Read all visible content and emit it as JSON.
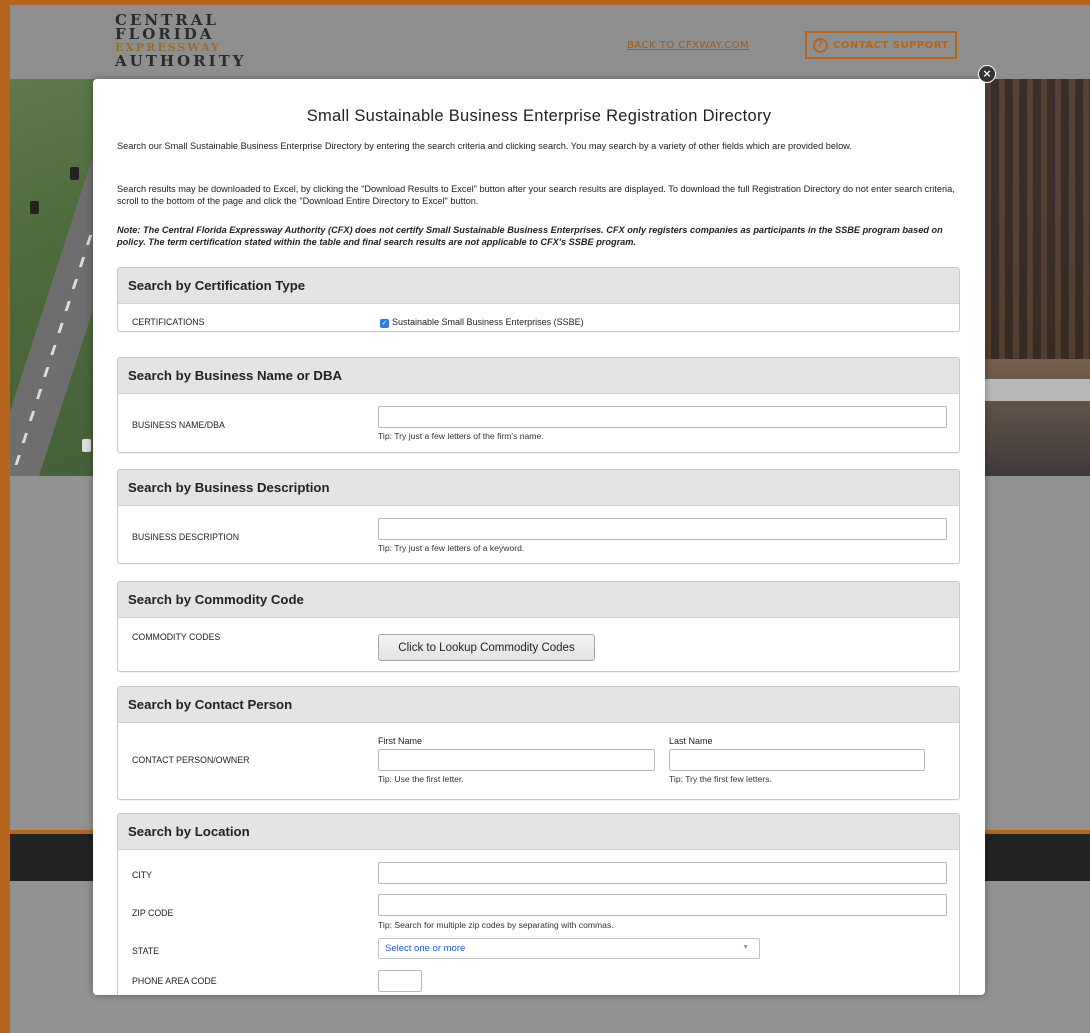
{
  "site": {
    "logo_lines": [
      "CENTRAL",
      "FLORIDA",
      "EXPRESSWAY",
      "AUTHORITY"
    ],
    "back_link": "BACK TO CFXWAY.COM",
    "support_label": "CONTACT SUPPORT",
    "brand_color": "#b5651d"
  },
  "modal": {
    "close_icon": "×",
    "title": "Small Sustainable Business Enterprise Registration Directory",
    "intro1": "Search our Small Sustainable Business Enterprise Directory by entering the search criteria and clicking search. You may search by a variety of other fields which are provided below.",
    "intro2": "Search results may be downloaded to Excel, by clicking the \"Download Results to Excel\" button after your search results are displayed. To download the full Registration Directory do not enter search criteria, scroll to the bottom of the page and click the \"Download Entire Directory to Excel\" button.",
    "note": "Note: The Central Florida Expressway Authority (CFX) does not certify Small Sustainable Business Enterprises. CFX only registers companies as participants in the SSBE program based on policy. The term certification stated within the table and final search results are not applicable to CFX's SSBE program."
  },
  "certification": {
    "heading": "Search by Certification Type",
    "label": "CERTIFICATIONS",
    "option": "Sustainable Small Business Enterprises (SSBE)",
    "checked": true
  },
  "business_name": {
    "heading": "Search by Business Name or DBA",
    "label": "BUSINESS NAME/DBA",
    "value": "",
    "tip": "Tip: Try just a few letters of the firm's name."
  },
  "business_description": {
    "heading": "Search by Business Description",
    "label": "BUSINESS DESCRIPTION",
    "value": "",
    "tip": "Tip: Try just a few letters of a keyword."
  },
  "commodity": {
    "heading": "Search by Commodity Code",
    "label": "COMMODITY CODES",
    "button": "Click to Lookup Commodity Codes"
  },
  "contact": {
    "heading": "Search by Contact Person",
    "label": "CONTACT PERSON/OWNER",
    "first_label": "First Name",
    "first_value": "",
    "first_tip": "Tip: Use the first letter.",
    "last_label": "Last Name",
    "last_value": "",
    "last_tip": "Tip: Try the first few letters."
  },
  "location": {
    "heading": "Search by Location",
    "city_label": "CITY",
    "city_value": "",
    "zip_label": "ZIP CODE",
    "zip_value": "",
    "zip_tip": "Tip: Search for multiple zip codes by separating with commas.",
    "state_label": "STATE",
    "state_placeholder": "Select one or more",
    "area_code_label": "PHONE AREA CODE",
    "area_code_value": ""
  }
}
